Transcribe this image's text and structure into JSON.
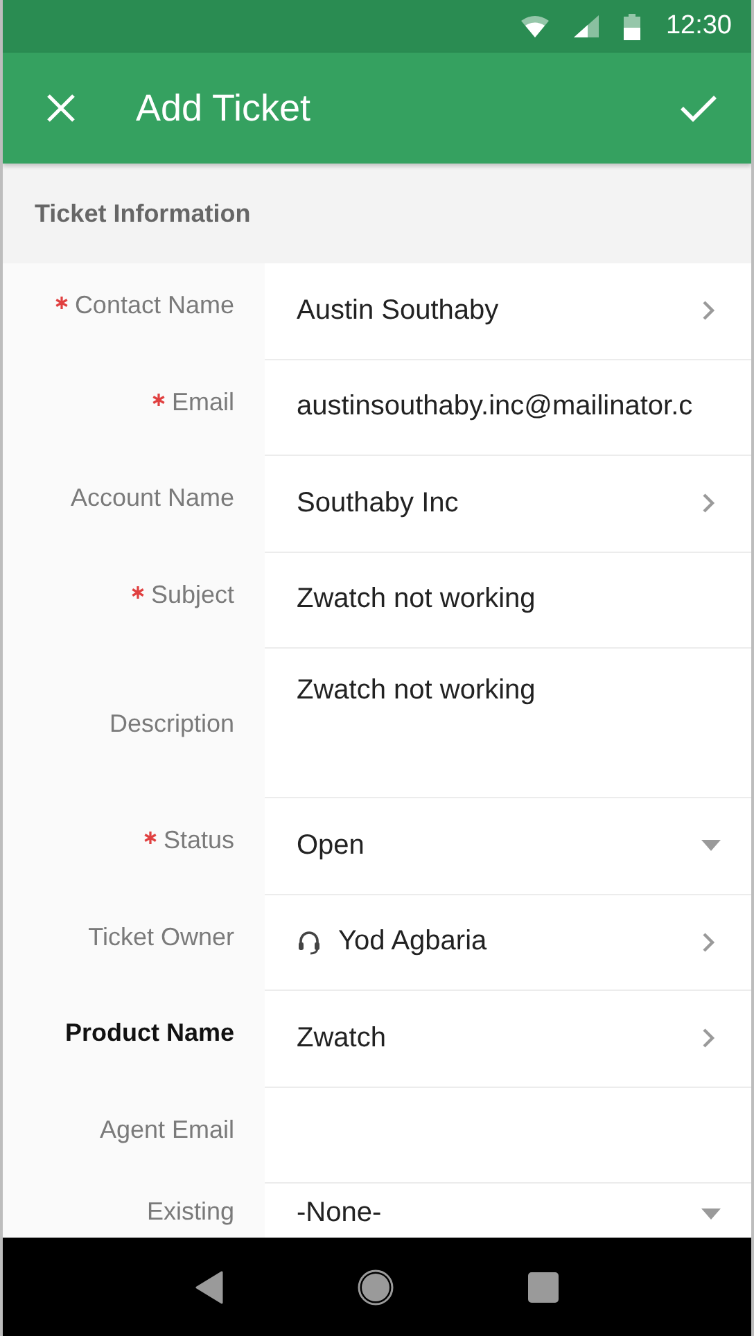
{
  "status_bar": {
    "time": "12:30"
  },
  "toolbar": {
    "title": "Add Ticket"
  },
  "section": {
    "title": "Ticket Information"
  },
  "fields": [
    {
      "label": "Contact Name",
      "required": true,
      "emphasized": false,
      "kind": "lookup",
      "value": "Austin Southaby"
    },
    {
      "label": "Email",
      "required": true,
      "emphasized": false,
      "kind": "text",
      "value": "austinsouthaby.inc@mailinator.c"
    },
    {
      "label": "Account Name",
      "required": false,
      "emphasized": false,
      "kind": "lookup",
      "value": "Southaby Inc"
    },
    {
      "label": "Subject",
      "required": true,
      "emphasized": false,
      "kind": "text",
      "value": "Zwatch not working"
    },
    {
      "label": "Description",
      "required": false,
      "emphasized": false,
      "kind": "textarea",
      "value": "Zwatch not working"
    },
    {
      "label": "Status",
      "required": true,
      "emphasized": false,
      "kind": "picklist",
      "value": "Open"
    },
    {
      "label": "Ticket Owner",
      "required": false,
      "emphasized": false,
      "kind": "user",
      "value": "Yod Agbaria"
    },
    {
      "label": "Product Name",
      "required": false,
      "emphasized": true,
      "kind": "lookup",
      "value": "Zwatch"
    },
    {
      "label": "Agent Email",
      "required": false,
      "emphasized": false,
      "kind": "text"
    },
    {
      "label": "Existing",
      "required": false,
      "emphasized": false,
      "kind": "picklist",
      "value": "-None-"
    }
  ]
}
